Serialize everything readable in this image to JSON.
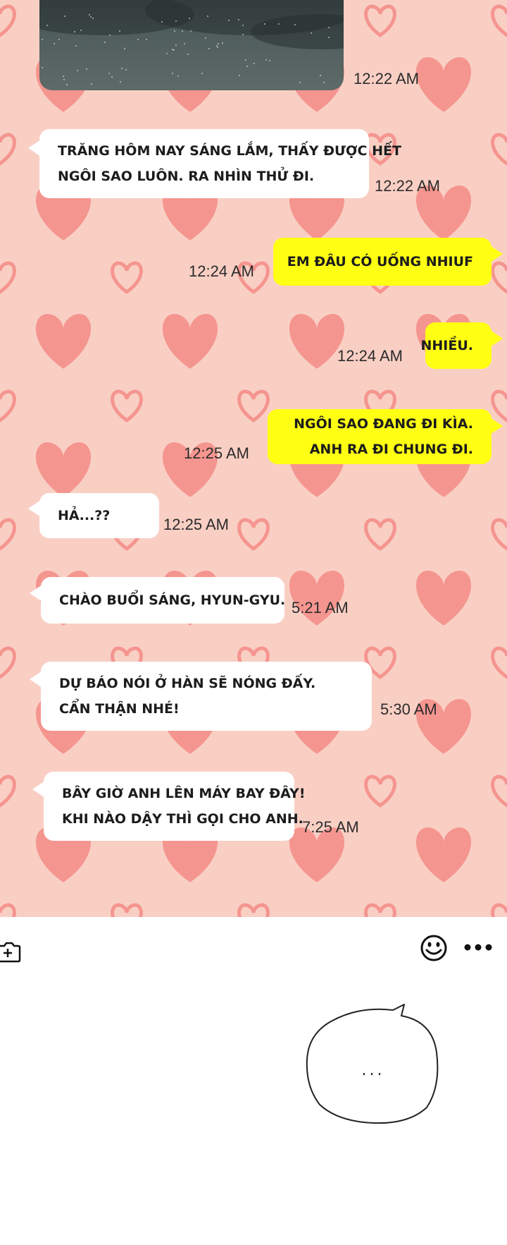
{
  "chat": {
    "messages": [
      {
        "side": "in",
        "lines": [
          "TRĂNG HÔM NAY SÁNG LẮM, THẤY ĐƯỢC HẾT",
          "NGÔI SAO LUÔN. RA NHÌN THỬ ĐI."
        ],
        "time": "12:22 AM"
      },
      {
        "side": "out",
        "lines": [
          "EM ĐÂU CÓ UỐNG NHIUF"
        ],
        "time": "12:24 AM"
      },
      {
        "side": "out",
        "lines": [
          "NHIỀU."
        ],
        "time": "12:24 AM"
      },
      {
        "side": "out",
        "lines": [
          "NGÔI SAO ĐANG ĐI KÌA.",
          "ANH RA ĐI CHUNG ĐI."
        ],
        "time": "12:25 AM"
      },
      {
        "side": "in",
        "lines": [
          "HẢ...??"
        ],
        "time": "12:25 AM"
      },
      {
        "side": "in",
        "lines": [
          "CHÀO BUỔI SÁNG, HYUN-GYU."
        ],
        "time": "5:21 AM"
      },
      {
        "side": "in",
        "lines": [
          "DỰ BÁO NÓI Ở HÀN SẼ NÓNG ĐẤY.",
          "CẨN THẬN NHÉ!"
        ],
        "time": "5:30 AM"
      },
      {
        "side": "in",
        "lines": [
          "BÂY GIỜ ANH LÊN MÁY BAY ĐÂY!",
          "KHI NÀO DẬY THÌ GỌI CHO ANH."
        ],
        "time": "7:25 AM"
      }
    ],
    "photo_time": "12:22 AM"
  },
  "toolbar": {
    "icons": [
      "add-photo-icon",
      "emoji-icon",
      "more-icon"
    ]
  },
  "speech": {
    "text": "..."
  },
  "colors": {
    "background": "#f9cfc4",
    "heart": "#f5958f",
    "incoming_bubble": "#ffffff",
    "outgoing_bubble": "#ffff14"
  }
}
